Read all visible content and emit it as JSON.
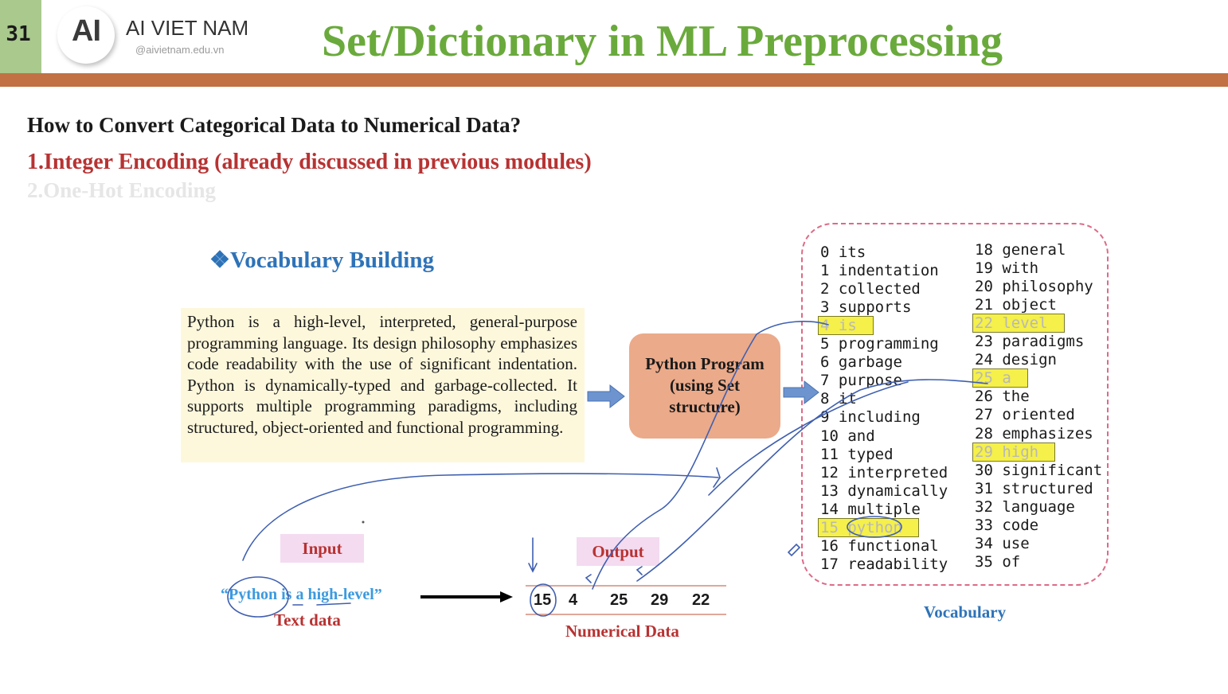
{
  "header": {
    "slide_number": "31",
    "logo_mark": "AI",
    "brand_name": "AI VIET NAM",
    "brand_url": "@aivietnam.edu.vn",
    "title": "Set/Dictionary in ML Preprocessing",
    "colors": {
      "title": "#6aaa3c",
      "bar": "#c17143",
      "number_box": "#a9c98d"
    }
  },
  "content": {
    "question": "How to Convert Categorical Data to Numerical Data?",
    "item1": "1.Integer Encoding (already discussed in previous modules)",
    "item2": "2.One-Hot Encoding",
    "vocab_heading": "❖Vocabulary Building",
    "paragraph": "Python is a high-level, interpreted, general-purpose programming language. Its design philosophy emphasizes code readability with the use of significant indentation. Python is dynamically-typed and garbage-collected. It supports multiple programming paradigms, including structured, object-oriented and functional programming.",
    "program_label_1": "Python Program",
    "program_label_2": "(using Set",
    "program_label_3": "structure)",
    "vocab_label": "Vocabulary",
    "input_label": "Input",
    "output_label": "Output",
    "input_text": "“Python is a high-level”",
    "text_data_label": "Text data",
    "numerical_label": "Numerical Data",
    "numbers": [
      "15",
      "4",
      "25",
      "29",
      "22"
    ]
  },
  "vocabulary": [
    "0 its",
    "1 indentation",
    "2 collected",
    "3 supports",
    "4 is",
    "5 programming",
    "6 garbage",
    "7 purpose",
    "8 it",
    "9 including",
    "10 and",
    "11 typed",
    "12 interpreted",
    "13 dynamically",
    "14 multiple",
    "15 python",
    "16 functional",
    "17 readability",
    "18 general",
    "19 with",
    "20 philosophy",
    "21 object",
    "22 level",
    "23 paradigms",
    "24 design",
    "25 a",
    "26 the",
    "27 oriented",
    "28 emphasizes",
    "29 high",
    "30 significant",
    "31 structured",
    "32 language",
    "33 code",
    "34 use",
    "35 of"
  ],
  "highlighted_indices": [
    4,
    15,
    22,
    25,
    29
  ]
}
